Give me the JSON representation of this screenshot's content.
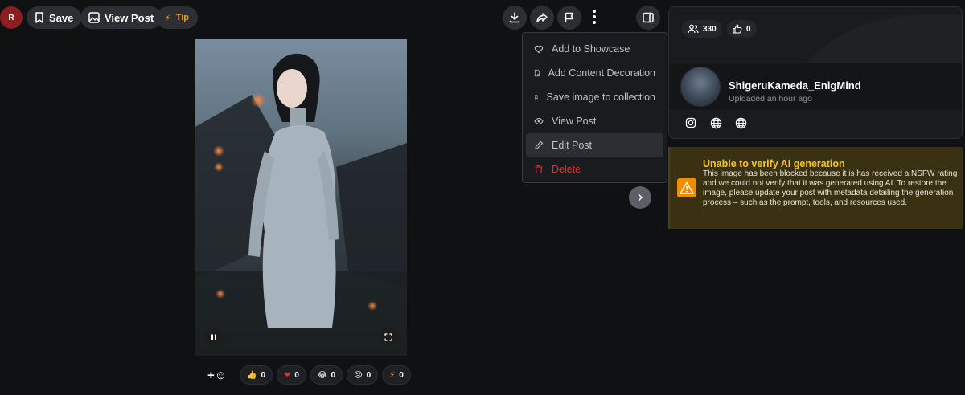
{
  "user_avatar": {
    "initial": "R"
  },
  "toolbar": {
    "save_label": "Save",
    "view_post_label": "View Post",
    "tip_label": "Tip"
  },
  "menu": {
    "items": [
      {
        "label": "Add to Showcase",
        "icon": "heart-icon"
      },
      {
        "label": "Add Content Decoration",
        "icon": "decoration-icon"
      },
      {
        "label": "Save image to collection",
        "icon": "bookmark-icon"
      },
      {
        "label": "View Post",
        "icon": "eye-icon"
      },
      {
        "label": "Edit Post",
        "icon": "pencil-icon"
      },
      {
        "label": "Delete",
        "icon": "trash-icon"
      }
    ]
  },
  "reactions": [
    {
      "emoji": "👍",
      "count": "0"
    },
    {
      "emoji": "❤",
      "count": "0"
    },
    {
      "emoji": "😂",
      "count": "0"
    },
    {
      "emoji": "😢",
      "count": "0"
    },
    {
      "emoji": "⚡",
      "count": "0"
    }
  ],
  "stats": {
    "followers": "330",
    "likes": "0"
  },
  "author": {
    "name": "ShigeruKameda_EnigMind",
    "uploaded": "Uploaded an hour ago"
  },
  "warning": {
    "title": "Unable to verify AI generation",
    "body": "This image has been blocked because it is has received a NSFW rating and we could not verify that it was generated using AI. To restore the image, please update your post with metadata detailing the generation process – such as the prompt, tools, and resources used."
  },
  "colors": {
    "background": "#101113",
    "accent_warning": "#fcc419",
    "danger": "#e03131",
    "tip": "#f59f00"
  }
}
